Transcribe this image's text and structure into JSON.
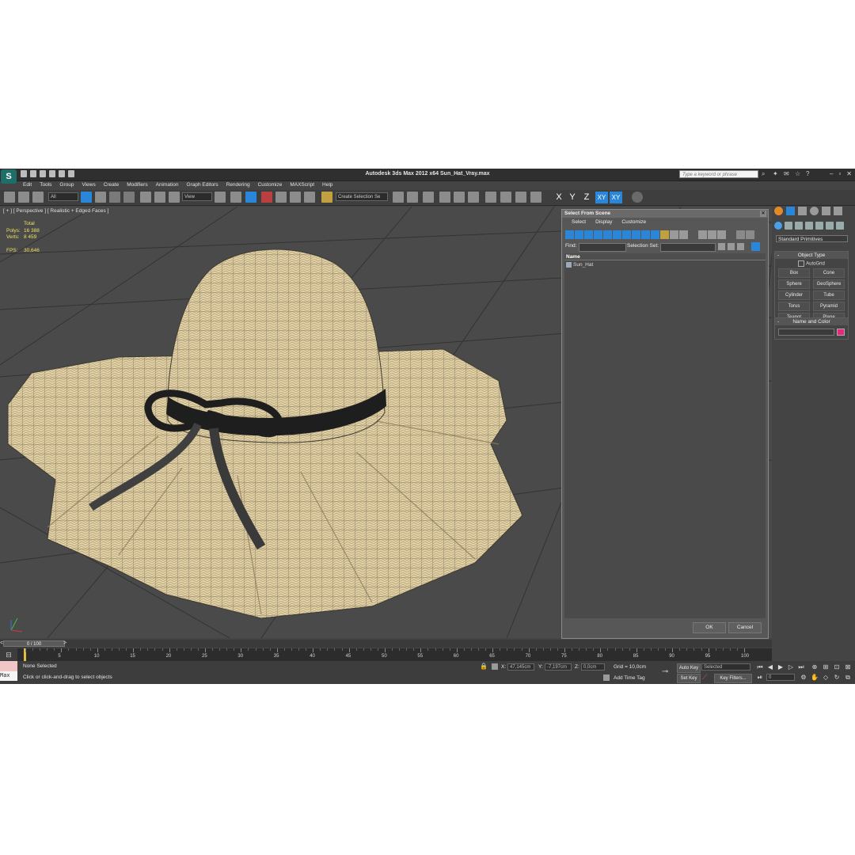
{
  "window": {
    "title": "Autodesk 3ds Max  2012 x64     Sun_Hat_Vray.max",
    "search_placeholder": "Type a keyword or phrase"
  },
  "menu": [
    "Edit",
    "Tools",
    "Group",
    "Views",
    "Create",
    "Modifiers",
    "Animation",
    "Graph Editors",
    "Rendering",
    "Customize",
    "MAXScript",
    "Help"
  ],
  "toolbar": {
    "filter_value": "All",
    "ref_coord_value": "View",
    "selection_set_value": "Create Selection Se",
    "axis": [
      "X",
      "Y",
      "Z",
      "XY",
      "XY"
    ]
  },
  "viewport": {
    "label": "[ + ] [ Perspective ] [ Realistic + Edged Faces ]",
    "stats": {
      "header": "Total",
      "rows": [
        {
          "key": "Polys:",
          "value": "16 388"
        },
        {
          "key": "Verts:",
          "value": "8 459"
        }
      ],
      "fps_key": "FPS:",
      "fps_value": "30,646"
    }
  },
  "dialog": {
    "title": "Select From Scene",
    "menu": [
      "Select",
      "Display",
      "Customize"
    ],
    "find_label": "Find:",
    "selection_set_label": "Selection Set:",
    "column_header": "Name",
    "items": [
      "Sun_Hat"
    ],
    "ok_label": "OK",
    "cancel_label": "Cancel"
  },
  "command_panel": {
    "category": "Standard Primitives",
    "object_type_title": "Object Type",
    "autogrid_label": "AutoGrid",
    "objects": [
      "Box",
      "Cone",
      "Sphere",
      "GeoSphere",
      "Cylinder",
      "Tube",
      "Torus",
      "Pyramid",
      "Teapot",
      "Plane"
    ],
    "name_color_title": "Name and Color",
    "color": "#e8287e"
  },
  "timeline": {
    "slider_label": "0 / 100",
    "ticks": [
      "0",
      "5",
      "10",
      "15",
      "20",
      "25",
      "30",
      "35",
      "40",
      "45",
      "50",
      "55",
      "60",
      "65",
      "70",
      "75",
      "80",
      "85",
      "90",
      "95",
      "100"
    ]
  },
  "status": {
    "maxscript_label": "Max",
    "selection_text": "None Selected",
    "prompt_text": "Click or click-and-drag to select objects",
    "x_label": "X:",
    "x_value": "47,145cm",
    "y_label": "Y:",
    "y_value": "-7,197cm",
    "z_label": "Z:",
    "z_value": "0,0cm",
    "grid_text": "Grid = 10,0cm",
    "add_time_tag": "Add Time Tag",
    "auto_key": "Auto Key",
    "set_key": "Set Key",
    "selected_dropdown": "Selected",
    "key_filters": "Key Filters...",
    "frame_value": "0"
  },
  "colors": {
    "accent_blue": "#2a86d8",
    "hat_straw": "#e2d2a8",
    "ribbon": "#1e1e1e"
  }
}
